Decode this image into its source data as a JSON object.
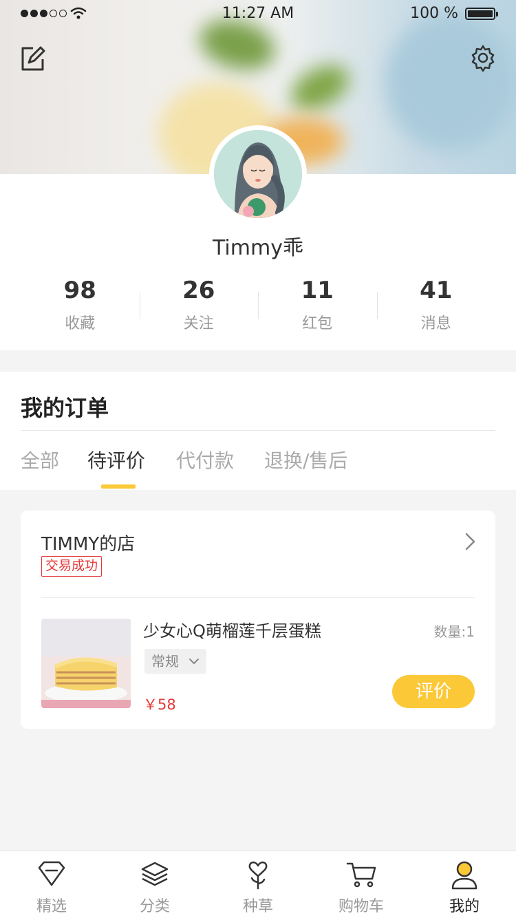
{
  "status_bar": {
    "time": "11:27 AM",
    "battery": "100 %"
  },
  "profile": {
    "username": "Timmy乖",
    "stats": [
      {
        "value": "98",
        "label": "收藏"
      },
      {
        "value": "26",
        "label": "关注"
      },
      {
        "value": "11",
        "label": "红包"
      },
      {
        "value": "41",
        "label": "消息"
      }
    ]
  },
  "orders": {
    "title": "我的订单",
    "tabs": [
      {
        "label": "全部",
        "active": false
      },
      {
        "label": "待评价",
        "active": true
      },
      {
        "label": "代付款",
        "active": false
      },
      {
        "label": "退换/售后",
        "active": false
      }
    ]
  },
  "order_card": {
    "shop_name": "TIMMY的店",
    "status": "交易成功",
    "product_name": "少女心Q萌榴莲千层蛋糕",
    "quantity": "数量:1",
    "spec": "常规",
    "price": "￥58",
    "action": "评价"
  },
  "tab_bar": [
    {
      "label": "精选",
      "icon": "diamond-icon"
    },
    {
      "label": "分类",
      "icon": "layers-icon"
    },
    {
      "label": "种草",
      "icon": "heart-sprout-icon"
    },
    {
      "label": "购物车",
      "icon": "cart-icon"
    },
    {
      "label": "我的",
      "icon": "user-icon",
      "active": true
    }
  ],
  "colors": {
    "accent": "#fbc837",
    "danger": "#e53838",
    "text": "#333333",
    "muted": "#999999"
  }
}
